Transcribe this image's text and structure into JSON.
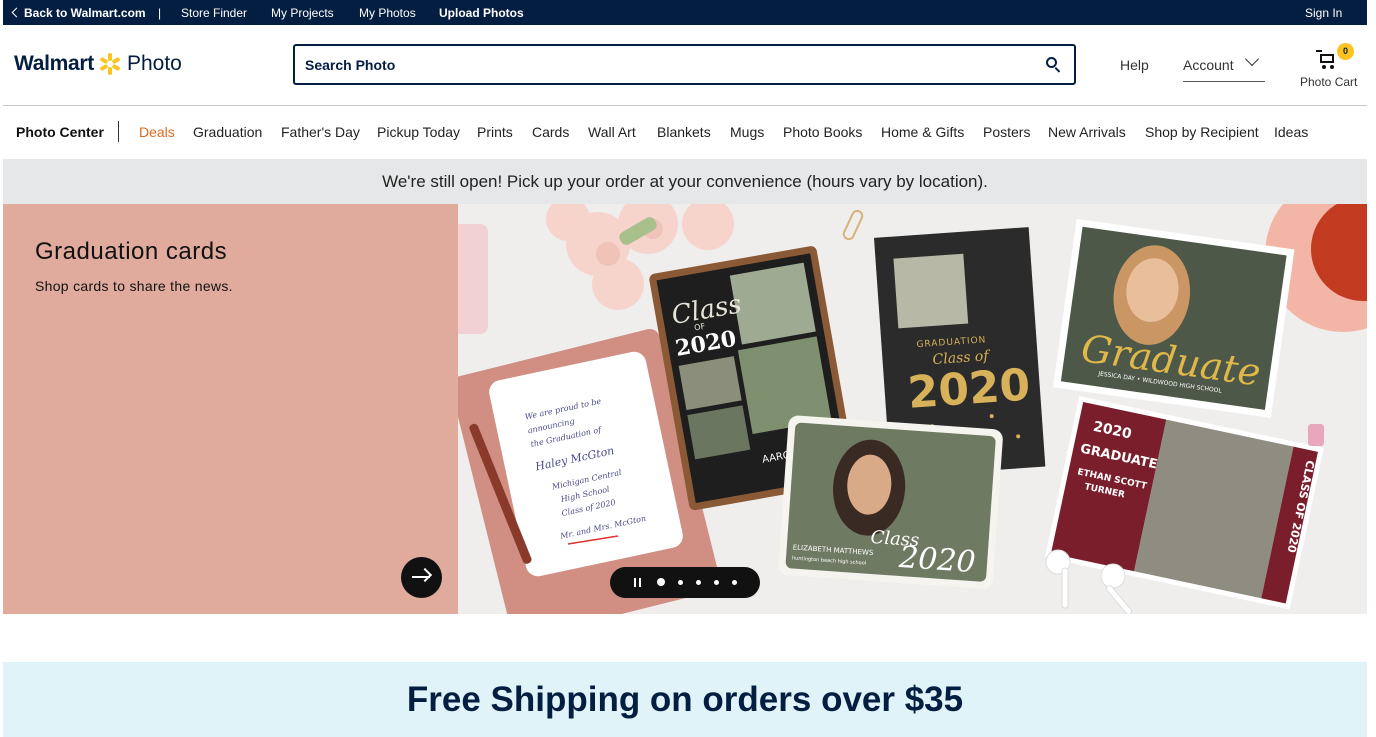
{
  "utility_bar": {
    "back_label": "Back to Walmart.com",
    "separator": "|",
    "store_finder": "Store Finder",
    "my_projects": "My Projects",
    "my_photos": "My Photos",
    "upload_photos": "Upload Photos",
    "sign_in": "Sign In"
  },
  "header": {
    "logo_brand": "Walmart",
    "logo_product": "Photo",
    "search_placeholder": "Search Photo",
    "help": "Help",
    "account": "Account",
    "cart_count": "0",
    "cart_label": "Photo Cart"
  },
  "nav": {
    "home": "Photo Center",
    "items": [
      "Deals",
      "Graduation",
      "Father's Day",
      "Pickup Today",
      "Prints",
      "Cards",
      "Wall Art",
      "Blankets",
      "Mugs",
      "Photo Books",
      "Home & Gifts",
      "Posters",
      "New Arrivals",
      "Shop by Recipient",
      "Ideas"
    ]
  },
  "notice": "We're still open! Pick up your order at your convenience (hours vary by location).",
  "hero": {
    "title": "Graduation cards",
    "subtitle": "Shop cards to share the news.",
    "image_texts": {
      "card1_line1": "Class",
      "card1_line2": "OF",
      "card1_year": "2020",
      "card1_name": "AARON SPENC",
      "card2_line1": "GRADUATION",
      "card2_line2": "Class of",
      "card2_year": "2020",
      "card3_title": "Graduate",
      "card3_name": "JESSICA DAY • WILDWOOD HIGH SCHOOL",
      "card4_year": "2020",
      "card4_title": "GRADUATE",
      "card4_name1": "ETHAN SCOTT",
      "card4_name2": "TURNER",
      "card4_side": "CLASS OF 2020",
      "card5_class": "Class",
      "card5_year": "2020",
      "card5_name": "ELIZABETH MATTHEWS",
      "card5_school": "huntington beach high school",
      "note_line1": "We are proud to be",
      "note_line2": "announcing",
      "note_line3": "the Graduation of",
      "note_name": "Haley McGton",
      "note_line5": "Michigan Central",
      "note_line6": "High School",
      "note_line7": "Class of 2020",
      "note_sign": "Mr. and Mrs. McGton"
    }
  },
  "carousel": {
    "slides": 5,
    "active": 1
  },
  "shipping_banner": "Free Shipping on orders over $35",
  "colors": {
    "navy": "#041e42",
    "spark_yellow": "#ffc220",
    "deals_orange": "#e06a1f",
    "hero_pink": "#e0ab9c",
    "notice_gray": "#e6e7e8",
    "shipping_bg": "#dff3f8"
  },
  "icons": [
    "chevron-left-icon",
    "spark-icon",
    "search-icon",
    "chevron-down-icon",
    "cart-icon",
    "pause-icon",
    "arrow-right-icon"
  ]
}
